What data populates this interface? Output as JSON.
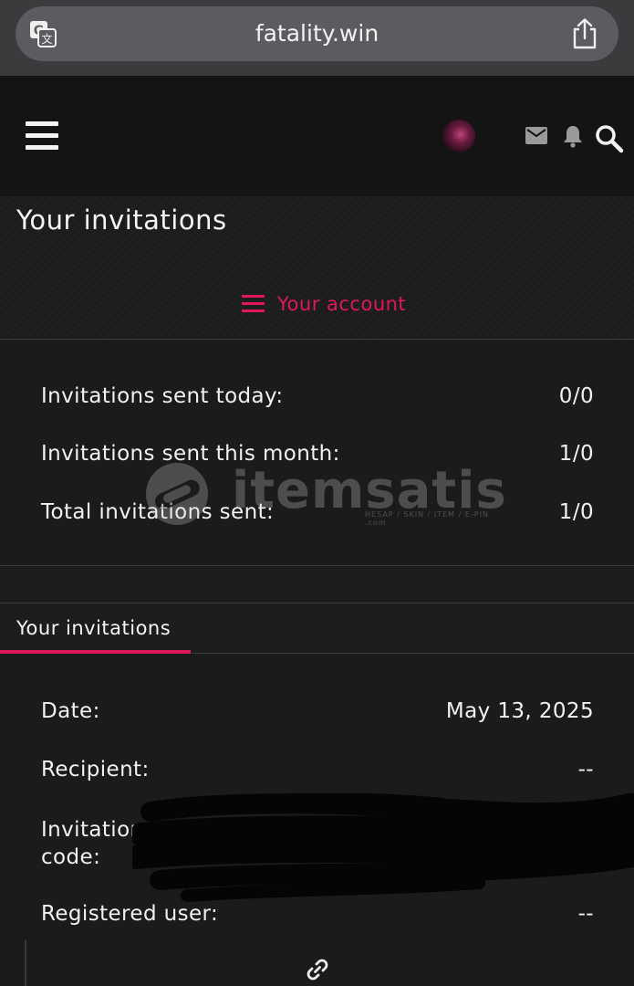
{
  "browser": {
    "url": "fatality.win"
  },
  "header": {
    "icons": [
      "menu-icon",
      "avatar",
      "mail-icon",
      "bell-icon",
      "search-icon"
    ]
  },
  "page": {
    "title": "Your invitations",
    "account_link": "Your account"
  },
  "stats": [
    {
      "label": "Invitations sent today:",
      "value": "0/0"
    },
    {
      "label": "Invitations sent this month:",
      "value": "1/0"
    },
    {
      "label": "Total invitations sent:",
      "value": "1/0"
    }
  ],
  "watermark": {
    "text": "itemsatis",
    "sub": "HESAP / SKIN / ITEM / E-PIN .com"
  },
  "tab": {
    "label": "Your invitations"
  },
  "details": [
    {
      "label": "Date:",
      "value": "May 13, 2025"
    },
    {
      "label": "Recipient:",
      "value": "--"
    },
    {
      "label": "Invitation code:",
      "value": ""
    },
    {
      "label": "Registered user:",
      "value": "--"
    }
  ],
  "colors": {
    "accent": "#e0175a",
    "background": "#1b1b1c",
    "header": "#141415"
  }
}
